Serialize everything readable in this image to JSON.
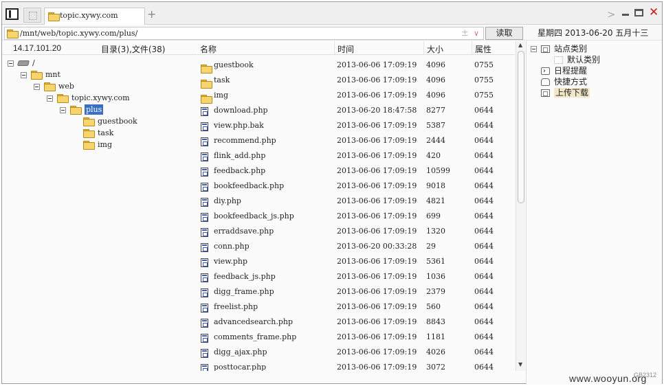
{
  "tabbar": {
    "tab_title": "topic.xywy.com",
    "add_tab": "+",
    "forward": ">",
    "close": "✕"
  },
  "addressbar": {
    "path": "/mnt/web/topic.xywy.com/plus/",
    "plus_minus": "±",
    "dropdown": "∨",
    "read_button": "读取",
    "date": "星期四 2013-06-20 五月十三"
  },
  "tree_header": {
    "ip": "14.17.101.20",
    "dir_count": "目录(3),文件(38)"
  },
  "tree": {
    "root": "/",
    "mnt": "mnt",
    "web": "web",
    "site": "topic.xywy.com",
    "plus": "plus",
    "children": [
      "guestbook",
      "task",
      "img"
    ]
  },
  "list_header": {
    "name": "名称",
    "time": "时间",
    "size": "大小",
    "perm": "属性"
  },
  "files": [
    {
      "type": "folder",
      "name": "guestbook",
      "time": "2013-06-06 17:09:19",
      "size": "4096",
      "perm": "0755"
    },
    {
      "type": "folder",
      "name": "task",
      "time": "2013-06-06 17:09:19",
      "size": "4096",
      "perm": "0755"
    },
    {
      "type": "folder",
      "name": "img",
      "time": "2013-06-06 17:09:19",
      "size": "4096",
      "perm": "0755"
    },
    {
      "type": "file",
      "name": "download.php",
      "time": "2013-06-20 18:47:58",
      "size": "8277",
      "perm": "0644"
    },
    {
      "type": "file",
      "name": "view.php.bak",
      "time": "2013-06-06 17:09:19",
      "size": "5387",
      "perm": "0644"
    },
    {
      "type": "file",
      "name": "recommend.php",
      "time": "2013-06-06 17:09:19",
      "size": "2444",
      "perm": "0644"
    },
    {
      "type": "file",
      "name": "flink_add.php",
      "time": "2013-06-06 17:09:19",
      "size": "420",
      "perm": "0644"
    },
    {
      "type": "file",
      "name": "feedback.php",
      "time": "2013-06-06 17:09:19",
      "size": "10599",
      "perm": "0644"
    },
    {
      "type": "file",
      "name": "bookfeedback.php",
      "time": "2013-06-06 17:09:19",
      "size": "9018",
      "perm": "0644"
    },
    {
      "type": "file",
      "name": "diy.php",
      "time": "2013-06-06 17:09:19",
      "size": "4821",
      "perm": "0644"
    },
    {
      "type": "file",
      "name": "bookfeedback_js.php",
      "time": "2013-06-06 17:09:19",
      "size": "699",
      "perm": "0644"
    },
    {
      "type": "file",
      "name": "erraddsave.php",
      "time": "2013-06-06 17:09:19",
      "size": "1320",
      "perm": "0644"
    },
    {
      "type": "file",
      "name": "conn.php",
      "time": "2013-06-20 00:33:28",
      "size": "29",
      "perm": "0644"
    },
    {
      "type": "file",
      "name": "view.php",
      "time": "2013-06-06 17:09:19",
      "size": "5361",
      "perm": "0644"
    },
    {
      "type": "file",
      "name": "feedback_js.php",
      "time": "2013-06-06 17:09:19",
      "size": "1036",
      "perm": "0644"
    },
    {
      "type": "file",
      "name": "digg_frame.php",
      "time": "2013-06-06 17:09:19",
      "size": "2379",
      "perm": "0644"
    },
    {
      "type": "file",
      "name": "freelist.php",
      "time": "2013-06-06 17:09:19",
      "size": "560",
      "perm": "0644"
    },
    {
      "type": "file",
      "name": "advancedsearch.php",
      "time": "2013-06-06 17:09:19",
      "size": "8843",
      "perm": "0644"
    },
    {
      "type": "file",
      "name": "comments_frame.php",
      "time": "2013-06-06 17:09:19",
      "size": "1181",
      "perm": "0644"
    },
    {
      "type": "file",
      "name": "digg_ajax.php",
      "time": "2013-06-06 17:09:19",
      "size": "4026",
      "perm": "0644"
    },
    {
      "type": "file",
      "name": "posttocar.php",
      "time": "2013-06-06 17:09:19",
      "size": "3072",
      "perm": "0644"
    }
  ],
  "right_panel": {
    "site_category": "站点类别",
    "default_category": "默认类别",
    "schedule": "日程提醒",
    "shortcuts": "快捷方式",
    "upload_download": "上传下载"
  },
  "footer": {
    "watermark": "www.wooyun.org",
    "corner_id": "GB2312"
  }
}
